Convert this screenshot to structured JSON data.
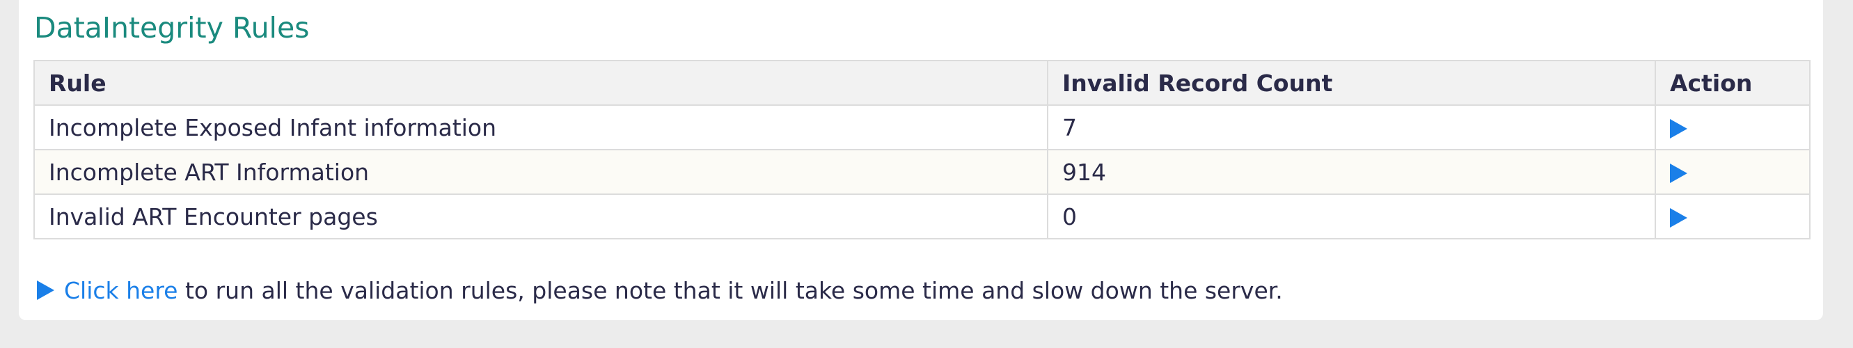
{
  "section": {
    "title": "DataIntegrity Rules"
  },
  "table": {
    "headers": {
      "rule": "Rule",
      "count": "Invalid Record Count",
      "action": "Action"
    },
    "rows": [
      {
        "rule": "Incomplete Exposed Infant information",
        "count": "7",
        "action_icon": "play-icon"
      },
      {
        "rule": "Incomplete ART Information",
        "count": "914",
        "action_icon": "play-icon"
      },
      {
        "rule": "Invalid ART Encounter pages",
        "count": "0",
        "action_icon": "play-icon"
      }
    ]
  },
  "footer": {
    "icon": "play-icon",
    "link_text": "Click here",
    "message": " to run all the validation rules, please note that it will take some time and slow down the server."
  },
  "colors": {
    "title": "#1a8a7e",
    "link": "#1a7fe8",
    "text": "#2a2a48",
    "background": "#ececec"
  }
}
